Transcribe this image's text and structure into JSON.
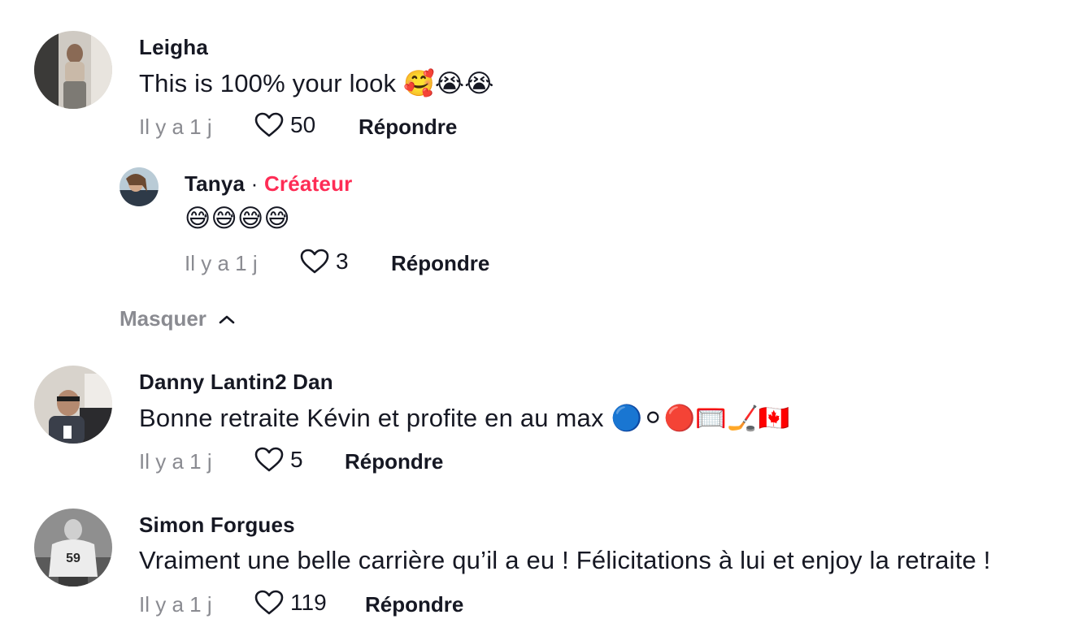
{
  "comments": [
    {
      "username": "Leigha",
      "text": "This is 100% your look 🥰😭😭",
      "time": "Il y a 1 j",
      "likes": "50",
      "reply_label": "Répondre"
    },
    {
      "username": "Tanya",
      "separator": "·",
      "creator_label": "Créateur",
      "text": "😅😅😅😅",
      "time": "Il y a 1 j",
      "likes": "3",
      "reply_label": "Répondre"
    },
    {
      "username": "Danny Lantin2 Dan",
      "text": "Bonne retraite Kévin et profite en au max 🔵⚪🔴🥅🏒🇨🇦",
      "time": "Il y a 1 j",
      "likes": "5",
      "reply_label": "Répondre"
    },
    {
      "username": "Simon Forgues",
      "text": "Vraiment une belle carrière qu’il a eu ! Félicitations à lui et enjoy la retraite !",
      "time": "Il y a 1 j",
      "likes": "119",
      "reply_label": "Répondre"
    }
  ],
  "hide_replies_label": "Masquer",
  "colors": {
    "creator": "#fe2c55",
    "meta": "#8a8b91",
    "text": "#161823"
  }
}
